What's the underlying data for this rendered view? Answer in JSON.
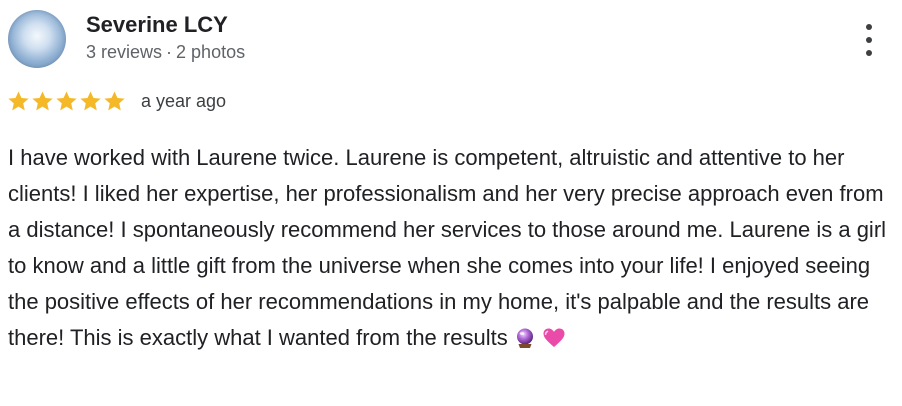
{
  "review": {
    "author": "Severine LCY",
    "reviews_count": "3 reviews",
    "photos_count": "2 photos",
    "separator": "·",
    "rating": 5,
    "time": "a year ago",
    "text": "I have worked with Laurene twice. Laurene is competent, altruistic and attentive to her clients! I liked her expertise, her professionalism and her very precise approach even from a distance! I spontaneously recommend her services to those around me. Laurene is a girl to know and a little gift from the universe when she comes into your life! I enjoyed seeing the positive effects of her recommendations in my home, it's palpable and the results are there! This is exactly what I wanted from the results",
    "emojis": [
      "crystal-ball-icon",
      "pink-heart-icon"
    ]
  },
  "icons": {
    "menu": "more-vert-icon",
    "star": "star-icon"
  },
  "colors": {
    "star": "#f5b927",
    "text": "#202124",
    "meta": "#5f6368"
  }
}
